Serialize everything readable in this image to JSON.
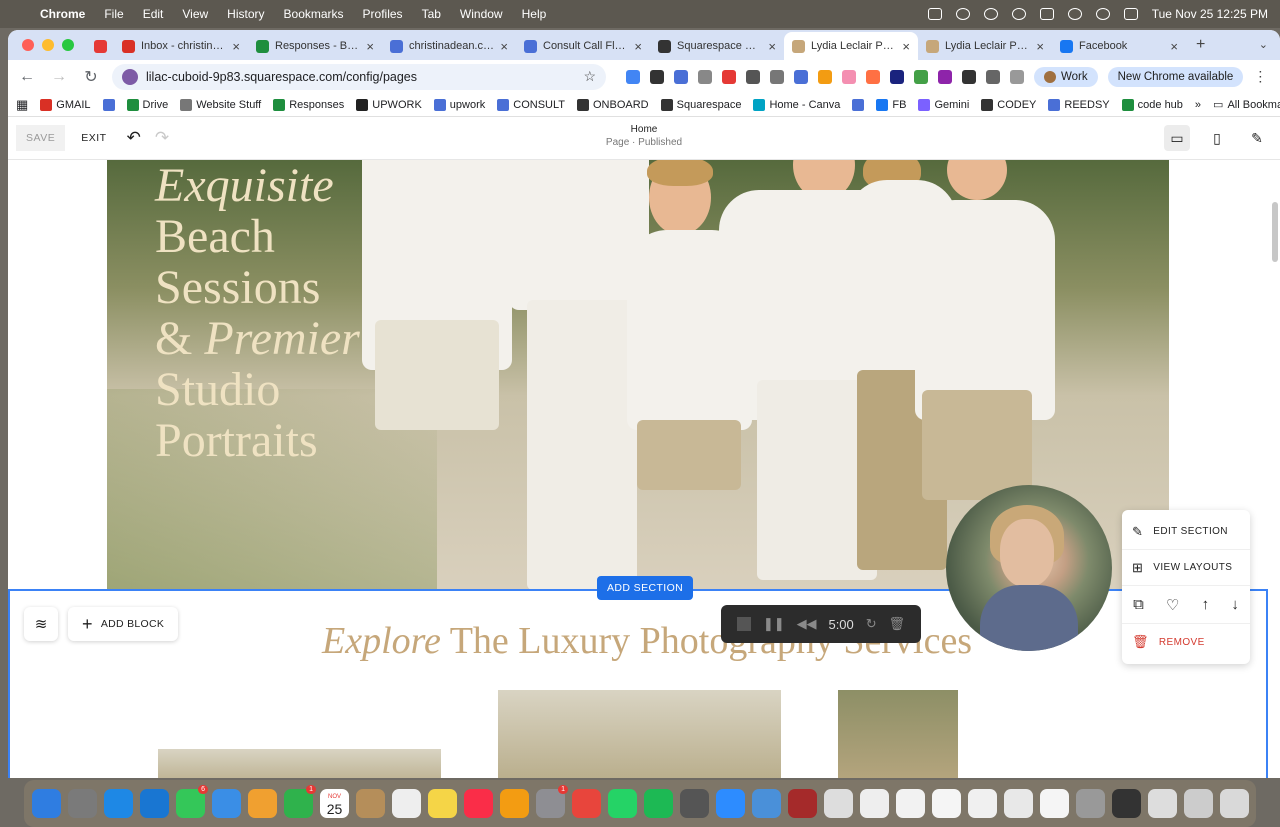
{
  "menubar": {
    "apple": "",
    "app": "Chrome",
    "items": [
      "File",
      "Edit",
      "View",
      "History",
      "Bookmarks",
      "Profiles",
      "Tab",
      "Window",
      "Help"
    ],
    "datetime": "Tue Nov 25  12:25 PM"
  },
  "tabs": [
    {
      "title": "",
      "color": "#e53935",
      "short": true
    },
    {
      "title": "Inbox - christina@c",
      "color": "#d93025"
    },
    {
      "title": "Responses - Bonsa",
      "color": "#1e8e3e"
    },
    {
      "title": "christinadean.co -",
      "color": "#4a6fd6"
    },
    {
      "title": "Consult Call Flow M",
      "color": "#4a6fd6"
    },
    {
      "title": "Squarespace — Ac",
      "color": "#333333"
    },
    {
      "title": "Lydia Leclair Photo",
      "color": "#c6a77a",
      "active": true
    },
    {
      "title": "Lydia Leclair Photo",
      "color": "#c6a77a"
    },
    {
      "title": "Facebook",
      "color": "#1877f2"
    }
  ],
  "toolbar": {
    "url": "lilac-cuboid-9p83.squarespace.com/config/pages",
    "profile": "Work",
    "update": "New Chrome available"
  },
  "bookmarks": [
    {
      "label": "GMAIL",
      "color": "#d93025"
    },
    {
      "label": "",
      "color": "#4a6fd6"
    },
    {
      "label": "Drive",
      "color": "#1e8e3e"
    },
    {
      "label": "Website Stuff",
      "color": "#777777"
    },
    {
      "label": "Responses",
      "color": "#1e8e3e"
    },
    {
      "label": "UPWORK",
      "color": "#222222"
    },
    {
      "label": "upwork",
      "color": "#4a6fd6"
    },
    {
      "label": "CONSULT",
      "color": "#4a6fd6"
    },
    {
      "label": "ONBOARD",
      "color": "#333333"
    },
    {
      "label": "Squarespace",
      "color": "#333333"
    },
    {
      "label": "Home - Canva",
      "color": "#00a3c4"
    },
    {
      "label": "",
      "color": "#4a6fd6"
    },
    {
      "label": "FB",
      "color": "#1877f2"
    },
    {
      "label": "Gemini",
      "color": "#7b61ff"
    },
    {
      "label": "CODEY",
      "color": "#333333"
    },
    {
      "label": "REEDSY",
      "color": "#4a6fd6"
    },
    {
      "label": "code hub",
      "color": "#1e8e3e"
    }
  ],
  "all_bookmarks": "All Bookmarks",
  "editor": {
    "save": "SAVE",
    "exit": "EXIT",
    "page_title": "Home",
    "page_status": "Page · Published"
  },
  "hero": {
    "line1": "Exquisite",
    "line2": "Beach",
    "line3": "Sessions",
    "line4_amp": "& ",
    "line4_it": "Premier",
    "line5": "Studio",
    "line6": "Portraits"
  },
  "add_section": "ADD SECTION",
  "section2": {
    "add_block": "ADD BLOCK",
    "title_it": "Explore",
    "title_rest": " The Luxury Photography Services"
  },
  "player": {
    "time": "5:00"
  },
  "context_menu": {
    "edit": "EDIT SECTION",
    "layouts": "VIEW LAYOUTS",
    "remove": "REMOVE"
  },
  "dock": [
    {
      "name": "finder",
      "color": "#2f7de1"
    },
    {
      "name": "launchpad",
      "color": "#7a7a7a"
    },
    {
      "name": "safari",
      "color": "#1e88e5"
    },
    {
      "name": "app-store",
      "color": "#1976d2"
    },
    {
      "name": "messages",
      "color": "#34c759",
      "badge": "6"
    },
    {
      "name": "mail",
      "color": "#3a8ee6"
    },
    {
      "name": "photos",
      "color": "#f0a030"
    },
    {
      "name": "facetime",
      "color": "#2fb24c",
      "badge": "1"
    },
    {
      "name": "calendar",
      "month": "NOV",
      "day": "25"
    },
    {
      "name": "contacts",
      "color": "#b58e5a"
    },
    {
      "name": "reminders",
      "color": "#eeeeee"
    },
    {
      "name": "notes",
      "color": "#f5d547"
    },
    {
      "name": "music",
      "color": "#fa2d48"
    },
    {
      "name": "pages",
      "color": "#f39c12"
    },
    {
      "name": "system-settings",
      "color": "#8e8e93",
      "badge": "1"
    },
    {
      "name": "chrome",
      "color": "#e8453c"
    },
    {
      "name": "whatsapp",
      "color": "#25d366"
    },
    {
      "name": "spotify",
      "color": "#1db954"
    },
    {
      "name": "calculator",
      "color": "#555555"
    },
    {
      "name": "zoom",
      "color": "#2d8cff"
    },
    {
      "name": "preview",
      "color": "#4a90d9"
    },
    {
      "name": "doc-1",
      "color": "#a52a2a"
    },
    {
      "name": "doc-2",
      "color": "#dddddd"
    },
    {
      "name": "doc-3",
      "color": "#eeeeee"
    },
    {
      "name": "doc-4",
      "color": "#f2f2f2"
    },
    {
      "name": "doc-5",
      "color": "#f5f5f5"
    },
    {
      "name": "doc-6",
      "color": "#f0f0f0"
    },
    {
      "name": "doc-7",
      "color": "#e8e8e8"
    },
    {
      "name": "doc-8",
      "color": "#f5f5f5"
    },
    {
      "name": "doc-9",
      "color": "#999999"
    },
    {
      "name": "doc-10",
      "color": "#333333"
    },
    {
      "name": "doc-11",
      "color": "#dddddd"
    },
    {
      "name": "doc-12",
      "color": "#cccccc"
    },
    {
      "name": "trash",
      "color": "#d9d9d9"
    }
  ]
}
